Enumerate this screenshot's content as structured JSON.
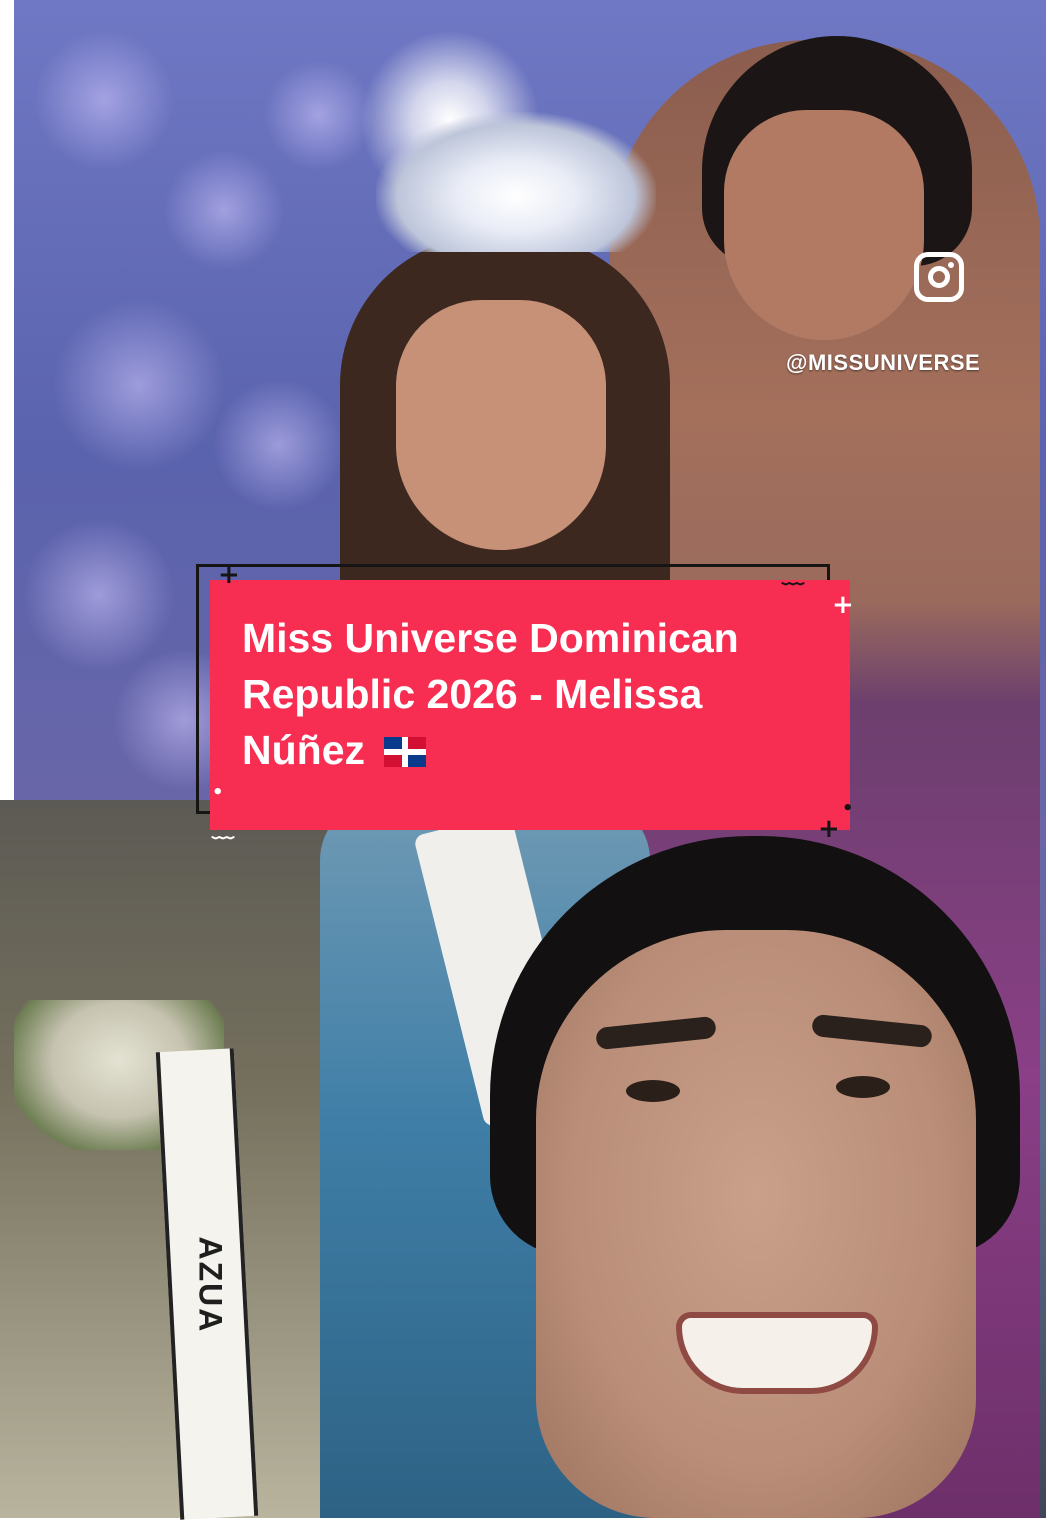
{
  "caption": {
    "line1": "Miss Universe Dominican",
    "line2": "Republic 2026 - Melissa",
    "line3": "Núñez",
    "background_color": "#f72d52",
    "text_color": "#ffffff",
    "flag_icon": "dominican-republic-flag-icon"
  },
  "watermark": {
    "icon": "instagram-icon",
    "handle": "@MISSUNIVERSE"
  },
  "scene": {
    "sash_text": "AZUA"
  }
}
